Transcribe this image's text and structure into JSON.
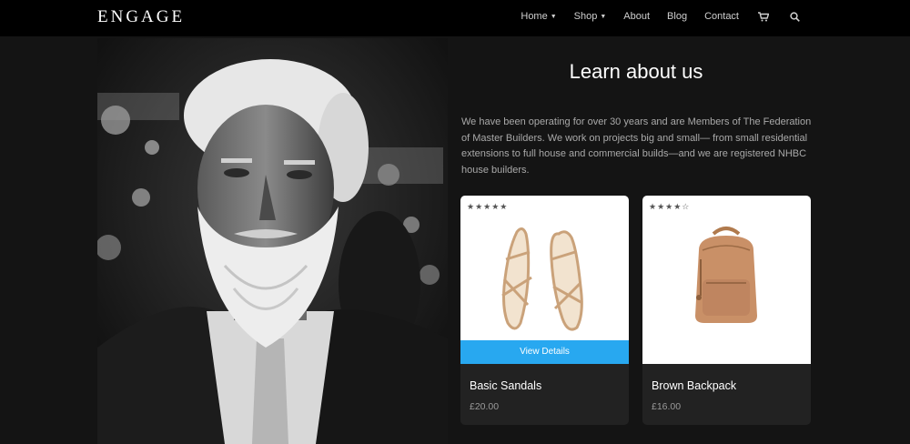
{
  "nav": {
    "brand": "ENGAGE",
    "items": [
      {
        "label": "Home",
        "dropdown": true
      },
      {
        "label": "Shop",
        "dropdown": true
      },
      {
        "label": "About",
        "dropdown": false
      },
      {
        "label": "Blog",
        "dropdown": false
      },
      {
        "label": "Contact",
        "dropdown": false
      }
    ],
    "icons": [
      "cart-icon",
      "search-icon"
    ]
  },
  "about": {
    "title": "Learn about us",
    "text": "We have been operating for over 30 years and are Members of The Federation of Master Builders. We work on projects big and small— from small residential extensions to full house and commercial builds—and we are registered NHBC house builders."
  },
  "products": [
    {
      "name": "Basic Sandals",
      "price": "£20.00",
      "rating": 5,
      "stars": "★★★★★",
      "button": "View Details"
    },
    {
      "name": "Brown Backpack",
      "price": "£16.00",
      "rating": 4,
      "stars": "★★★★☆"
    }
  ],
  "colors": {
    "nav_bg": "#000000",
    "page_bg": "#141414",
    "accent": "#28a8f0",
    "card_bg": "#222222"
  }
}
